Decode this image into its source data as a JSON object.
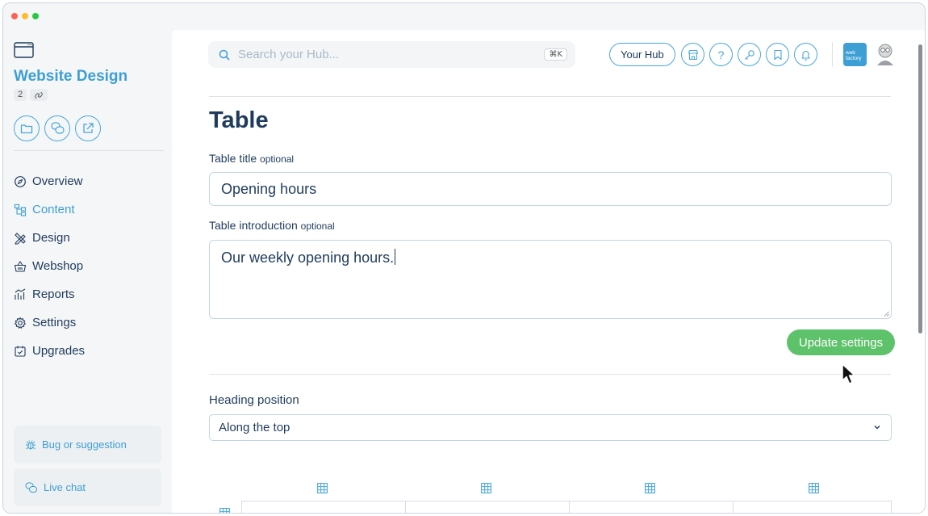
{
  "window": {
    "traffic_colors": [
      "#fe5f57",
      "#febc2e",
      "#28c840"
    ]
  },
  "sidebar": {
    "site_title": "Website Design",
    "count": "2",
    "circle_buttons": [
      "folder-icon",
      "chat-icon",
      "external-link-icon"
    ],
    "items": [
      {
        "label": "Overview",
        "icon": "compass-icon",
        "active": false
      },
      {
        "label": "Content",
        "icon": "sitemap-icon",
        "active": true
      },
      {
        "label": "Design",
        "icon": "pencil-ruler-icon",
        "active": false
      },
      {
        "label": "Webshop",
        "icon": "basket-icon",
        "active": false
      },
      {
        "label": "Reports",
        "icon": "bar-chart-icon",
        "active": false
      },
      {
        "label": "Settings",
        "icon": "gear-icon",
        "active": false
      },
      {
        "label": "Upgrades",
        "icon": "calendar-check-icon",
        "active": false
      }
    ],
    "bug_label": "Bug or suggestion",
    "chat_label": "Live chat"
  },
  "topbar": {
    "search_placeholder": "Search your Hub...",
    "shortcut": "⌘K",
    "hub_button": "Your Hub",
    "brand_logo_text": "web factory",
    "icons": [
      "store-icon",
      "help-icon",
      "key-icon",
      "bookmark-icon",
      "bell-icon"
    ]
  },
  "form": {
    "page_title": "Table",
    "title_label": "Table title",
    "intro_label": "Table introduction",
    "optional": "optional",
    "title_value": "Opening hours",
    "intro_value": "Our weekly opening hours.",
    "update_button": "Update settings",
    "heading_label": "Heading position",
    "heading_value": "Along the top"
  },
  "colors": {
    "accent": "#3d9fd4",
    "button_green": "#5dc26a",
    "text_dark": "#1f3b5c"
  }
}
